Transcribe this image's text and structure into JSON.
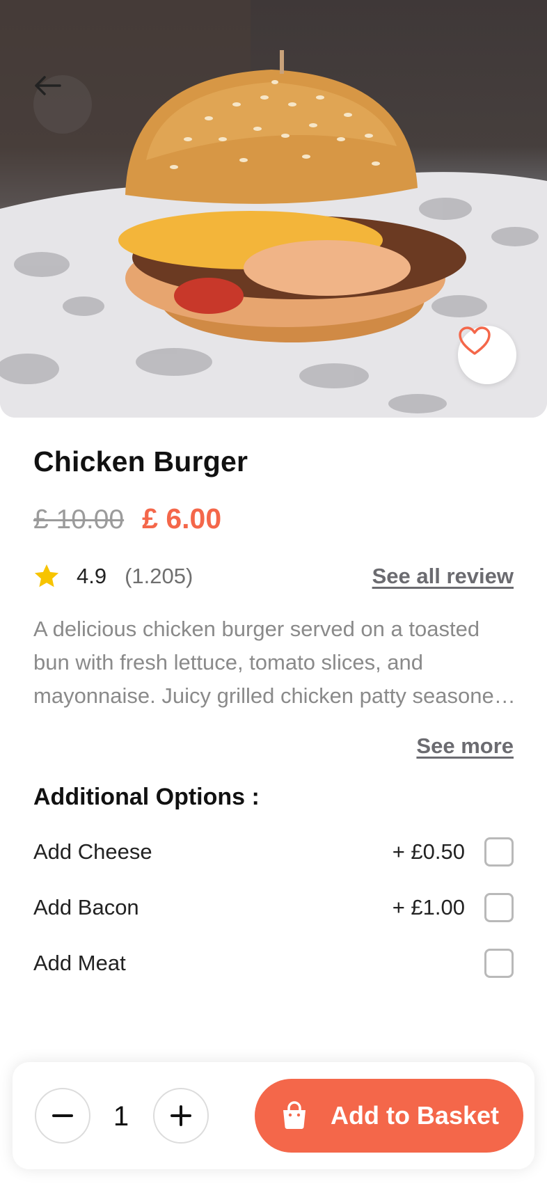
{
  "product": {
    "name": "Chicken Burger",
    "old_price": "£ 10.00",
    "price": "£ 6.00",
    "rating": "4.9",
    "review_count": "(1.205)",
    "see_all_reviews": "See all review",
    "description": "A delicious chicken burger served on a toasted bun with fresh lettuce, tomato slices, and mayonnaise. Juicy grilled chicken patty seasoned with herbs and spices.",
    "see_more": "See more"
  },
  "options": {
    "title": "Additional Options :",
    "items": [
      {
        "label": "Add Cheese",
        "price": "+ £0.50",
        "checked": false
      },
      {
        "label": "Add Bacon",
        "price": "+ £1.00",
        "checked": false
      },
      {
        "label": "Add Meat",
        "price": "",
        "checked": false
      }
    ]
  },
  "cart": {
    "quantity": "1",
    "add_label": "Add to Basket"
  },
  "icons": {
    "back": "arrow-left-icon",
    "favorite": "heart-icon",
    "rating": "star-icon",
    "decrease": "minus-icon",
    "increase": "plus-icon",
    "basket": "shopping-bag-icon"
  },
  "colors": {
    "accent": "#f4674a",
    "star": "#f7c400",
    "muted_text": "#8a8a8a"
  }
}
